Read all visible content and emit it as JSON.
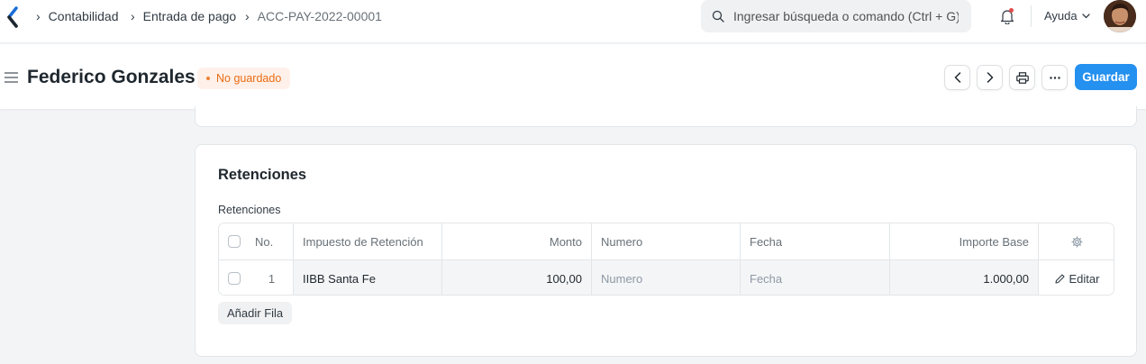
{
  "navbar": {
    "breadcrumbs": [
      "Contabilidad",
      "Entrada de pago",
      "ACC-PAY-2022-00001"
    ],
    "search_placeholder": "Ingresar búsqueda o comando (Ctrl + G)",
    "help_label": "Ayuda"
  },
  "page": {
    "title": "Federico Gonzales",
    "status_badge": "No guardado",
    "save_label": "Guardar"
  },
  "section": {
    "title": "Retenciones",
    "field_label": "Retenciones",
    "columns": [
      "No.",
      "Impuesto de Retención",
      "Monto",
      "Numero",
      "Fecha",
      "Importe Base"
    ],
    "rows": [
      {
        "no": "1",
        "impuesto": "IIBB Santa Fe",
        "monto": "100,00",
        "numero_placeholder": "Numero",
        "fecha_placeholder": "Fecha",
        "importe_base": "1.000,00",
        "edit_label": "Editar"
      }
    ],
    "add_row_label": "Añadir Fila"
  },
  "colors": {
    "primary": "#2490ef",
    "badge_bg": "#fff1ea",
    "badge_text": "#e86c13"
  }
}
